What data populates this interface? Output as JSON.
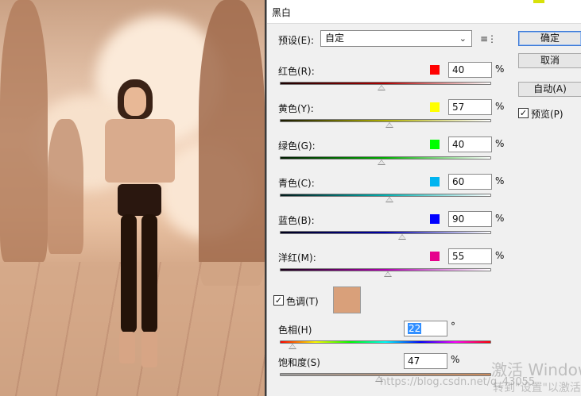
{
  "dialog": {
    "title": "黑白",
    "preset_label": "预设(E):",
    "preset_value": "自定",
    "buttons": {
      "ok": "确定",
      "cancel": "取消",
      "auto": "自动(A)"
    },
    "preview": {
      "label": "预览(P)",
      "checked": true
    }
  },
  "sliders": [
    {
      "label": "红色(R):",
      "value": "40",
      "fraction": 0.48,
      "swatch": "#ff0000",
      "gradient": [
        "#1a0000",
        "#b00000",
        "#ffffff"
      ]
    },
    {
      "label": "黄色(Y):",
      "value": "57",
      "fraction": 0.52,
      "swatch": "#ffff00",
      "gradient": [
        "#1a1a00",
        "#b0b000",
        "#ffffff"
      ]
    },
    {
      "label": "绿色(G):",
      "value": "40",
      "fraction": 0.48,
      "swatch": "#00ff00",
      "gradient": [
        "#001a00",
        "#00b000",
        "#ffffff"
      ]
    },
    {
      "label": "青色(C):",
      "value": "60",
      "fraction": 0.52,
      "swatch": "#00b4f0",
      "gradient": [
        "#001a1a",
        "#00b0b0",
        "#ffffff"
      ]
    },
    {
      "label": "蓝色(B):",
      "value": "90",
      "fraction": 0.58,
      "swatch": "#0000ff",
      "gradient": [
        "#00001a",
        "#0000b0",
        "#ffffff"
      ]
    },
    {
      "label": "洋红(M):",
      "value": "55",
      "fraction": 0.51,
      "swatch": "#e6008c",
      "gradient": [
        "#1a001a",
        "#b000b0",
        "#ffffff"
      ]
    }
  ],
  "tint": {
    "label": "色调(T)",
    "checked": true,
    "color": "#d9a07a"
  },
  "hue": {
    "label": "色相(H)",
    "value": "22",
    "unit": "°",
    "fraction": 0.06
  },
  "saturation": {
    "label": "饱和度(S)",
    "value": "47",
    "unit": "%",
    "fraction": 0.47,
    "gradient": [
      "#9a9a9a",
      "#c98a5c"
    ]
  },
  "percent_sign": "%",
  "watermarks": {
    "windows_line1": "激活 Windows",
    "windows_line2": "转到\"设置\"以激活",
    "csdn": "https://blog.csdn.net/q_43055"
  }
}
